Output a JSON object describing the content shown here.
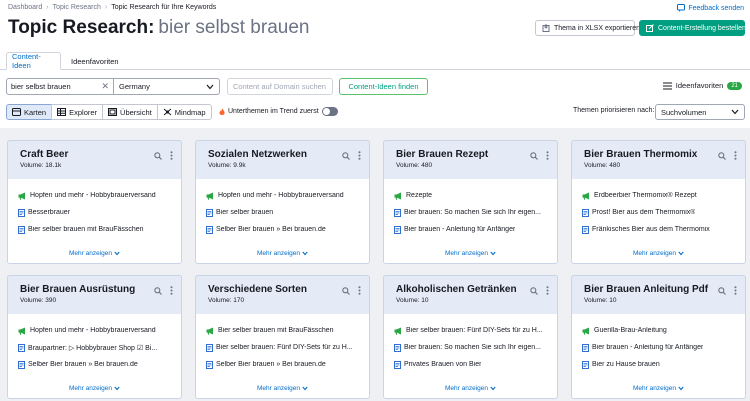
{
  "breadcrumbs": [
    "Dashboard",
    "Topic Research",
    "Topic Research für Ihre Keywords"
  ],
  "feedback_label": "Feedback senden",
  "page_title": "Topic Research:",
  "page_query": "bier selbst brauen",
  "buttons": {
    "export": "Thema in XLSX exportieren",
    "create": "Content-Erstellung bestellen",
    "find": "Content-Ideen finden"
  },
  "tabs": [
    "Content-Ideen",
    "Ideenfavoriten"
  ],
  "search": {
    "value": "bier selbst brauen",
    "country": "Germany",
    "domain_placeholder": "Content auf Domain suchen"
  },
  "favorites": {
    "label": "Ideenfavoriten",
    "count": "21"
  },
  "views": [
    "Karten",
    "Explorer",
    "Übersicht",
    "Mindmap"
  ],
  "trend_label": "Unterthemen im Trend zuerst",
  "prioritize": {
    "label": "Themen priorisieren nach:",
    "value": "Suchvolumen"
  },
  "more_label": "Mehr anzeigen",
  "cards": [
    {
      "title": "Craft Beer",
      "volume": "Volume: 18.1k",
      "items": [
        {
          "icon": "megaphone-icon",
          "text": "Hopfen und mehr - Hobbybrauerversand"
        },
        {
          "icon": "document-icon",
          "text": "Besserbrauer"
        },
        {
          "icon": "document-icon",
          "text": "Bier selber brauen mit BrauFässchen"
        }
      ]
    },
    {
      "title": "Sozialen Netzwerken",
      "volume": "Volume: 9.9k",
      "items": [
        {
          "icon": "megaphone-icon",
          "text": "Hopfen und mehr - Hobbybrauerversand"
        },
        {
          "icon": "document-icon",
          "text": "Bier selber brauen"
        },
        {
          "icon": "document-icon",
          "text": "Selber Bier brauen » Bei brauen.de"
        }
      ]
    },
    {
      "title": "Bier Brauen Rezept",
      "volume": "Volume: 480",
      "items": [
        {
          "icon": "megaphone-icon",
          "text": "Rezepte"
        },
        {
          "icon": "document-icon",
          "text": "Bier brauen: So machen Sie sich Ihr eigen..."
        },
        {
          "icon": "document-icon",
          "text": "Bier brauen - Anleitung für Anfänger"
        }
      ]
    },
    {
      "title": "Bier Brauen Thermomix",
      "volume": "Volume: 480",
      "items": [
        {
          "icon": "megaphone-icon",
          "text": "Erdbeerbier Thermomix® Rezept"
        },
        {
          "icon": "document-icon",
          "text": "Prost! Bier aus dem Thermomix®"
        },
        {
          "icon": "document-icon",
          "text": "Fränkisches Bier aus dem Thermomix"
        }
      ]
    },
    {
      "title": "Bier Brauen Ausrüstung",
      "volume": "Volume: 390",
      "items": [
        {
          "icon": "megaphone-icon",
          "text": "Hopfen und mehr - Hobbybrauerversand"
        },
        {
          "icon": "document-icon",
          "text": "Braupartner: ▷ Hobbybrauer Shop ☑ Bi..."
        },
        {
          "icon": "document-icon",
          "text": "Selber Bier brauen » Bei brauen.de"
        }
      ]
    },
    {
      "title": "Verschiedene Sorten",
      "volume": "Volume: 170",
      "items": [
        {
          "icon": "megaphone-icon",
          "text": "Bier selber brauen mit BrauFässchen"
        },
        {
          "icon": "document-icon",
          "text": "Bier selber brauen: Fünf DIY-Sets für zu H..."
        },
        {
          "icon": "document-icon",
          "text": "Selber Bier brauen » Bei brauen.de"
        }
      ]
    },
    {
      "title": "Alkoholischen Getränken",
      "volume": "Volume: 10",
      "items": [
        {
          "icon": "megaphone-icon",
          "text": "Bier selber brauen: Fünf DIY-Sets für zu H..."
        },
        {
          "icon": "document-icon",
          "text": "Bier brauen: So machen Sie sich Ihr eigen..."
        },
        {
          "icon": "document-icon",
          "text": "Privates Brauen von Bier"
        }
      ]
    },
    {
      "title": "Bier Brauen Anleitung Pdf",
      "volume": "Volume: 10",
      "items": [
        {
          "icon": "megaphone-icon",
          "text": "Guerilla-Brau-Anleitung"
        },
        {
          "icon": "document-icon",
          "text": "Bier brauen - Anleitung für Anfänger"
        },
        {
          "icon": "document-icon",
          "text": "Bier zu Hause brauen"
        }
      ]
    }
  ],
  "colors": {
    "accent": "#006dca",
    "create": "#009f81",
    "card_head": "#e4ebf6",
    "megaphone": "#29a745",
    "document": "#2f6fd1"
  }
}
